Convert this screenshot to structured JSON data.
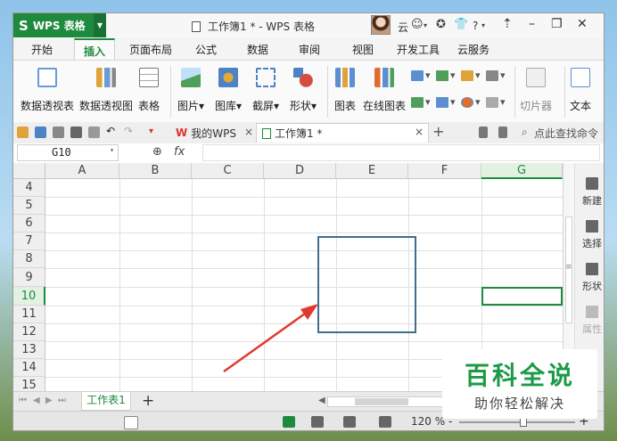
{
  "app": {
    "name": "WPS 表格",
    "logo_glyph": "S",
    "window_title": "工作簿1 * - WPS 表格",
    "user_short": "云",
    "help_glyph": "?"
  },
  "menu": {
    "tabs": [
      "开始",
      "插入",
      "页面布局",
      "公式",
      "数据",
      "审阅",
      "视图",
      "开发工具",
      "云服务"
    ],
    "active": "插入"
  },
  "ribbon": {
    "buttons": [
      {
        "label": "数据透视表",
        "icon": "pivot-table-icon",
        "color": "#6b9bd2"
      },
      {
        "label": "数据透视图",
        "icon": "pivot-chart-icon",
        "color": "#e0a33b"
      },
      {
        "label": "表格",
        "icon": "table-icon",
        "color": "#8a8a8a"
      },
      {
        "label": "图片",
        "icon": "picture-icon",
        "color": "#4f9e5a"
      },
      {
        "label": "图库",
        "icon": "gallery-icon",
        "color": "#e5a93a"
      },
      {
        "label": "截屏",
        "icon": "screenshot-icon",
        "color": "#4d82c4"
      },
      {
        "label": "形状",
        "icon": "shapes-icon",
        "color": "#d44c3f"
      },
      {
        "label": "图表",
        "icon": "chart-icon",
        "color": "#5c8fd0"
      },
      {
        "label": "在线图表",
        "icon": "online-chart-icon",
        "color": "#e06d2e"
      },
      {
        "label": "切片器",
        "icon": "slicer-icon",
        "color": "#9a9a9a"
      },
      {
        "label": "文本",
        "icon": "textbox-icon",
        "color": "#5c8fd0"
      }
    ],
    "dropdown_mark": "▾"
  },
  "quickbar": {
    "tabs": [
      {
        "label": "我的WPS",
        "icon": "wps-logo-icon"
      },
      {
        "label": "工作簿1 *",
        "icon": "spreadsheet-doc-icon"
      }
    ],
    "close_glyph": "×",
    "add_glyph": "+",
    "search_label": "点此查找命令"
  },
  "formula_bar": {
    "cell_ref": "G10",
    "fx_label": "fx",
    "value": ""
  },
  "sheet": {
    "columns": [
      "A",
      "B",
      "C",
      "D",
      "E",
      "F",
      "G"
    ],
    "rows": [
      "4",
      "5",
      "6",
      "7",
      "8",
      "9",
      "10",
      "11",
      "12",
      "13",
      "14",
      "15"
    ],
    "selected_column": "G",
    "selected_row": "10"
  },
  "side_panel": {
    "items": [
      {
        "label": "新建",
        "icon": "new-file-icon",
        "enabled": true
      },
      {
        "label": "选择",
        "icon": "select-cursor-icon",
        "enabled": true
      },
      {
        "label": "形状",
        "icon": "shapes-icon",
        "enabled": true
      },
      {
        "label": "属性",
        "icon": "properties-icon",
        "enabled": false
      }
    ]
  },
  "sheet_tabs": {
    "names": [
      "工作表1"
    ],
    "add_glyph": "+"
  },
  "status": {
    "zoom": "120 %",
    "zoom_minus": "-",
    "zoom_plus": "+"
  },
  "watermark": {
    "title": "百科全说",
    "subtitle": "助你轻松解决"
  },
  "colors": {
    "accent": "#1d8a3e",
    "annotation_box": "#3d6e92",
    "arrow": "#e03a2e"
  }
}
